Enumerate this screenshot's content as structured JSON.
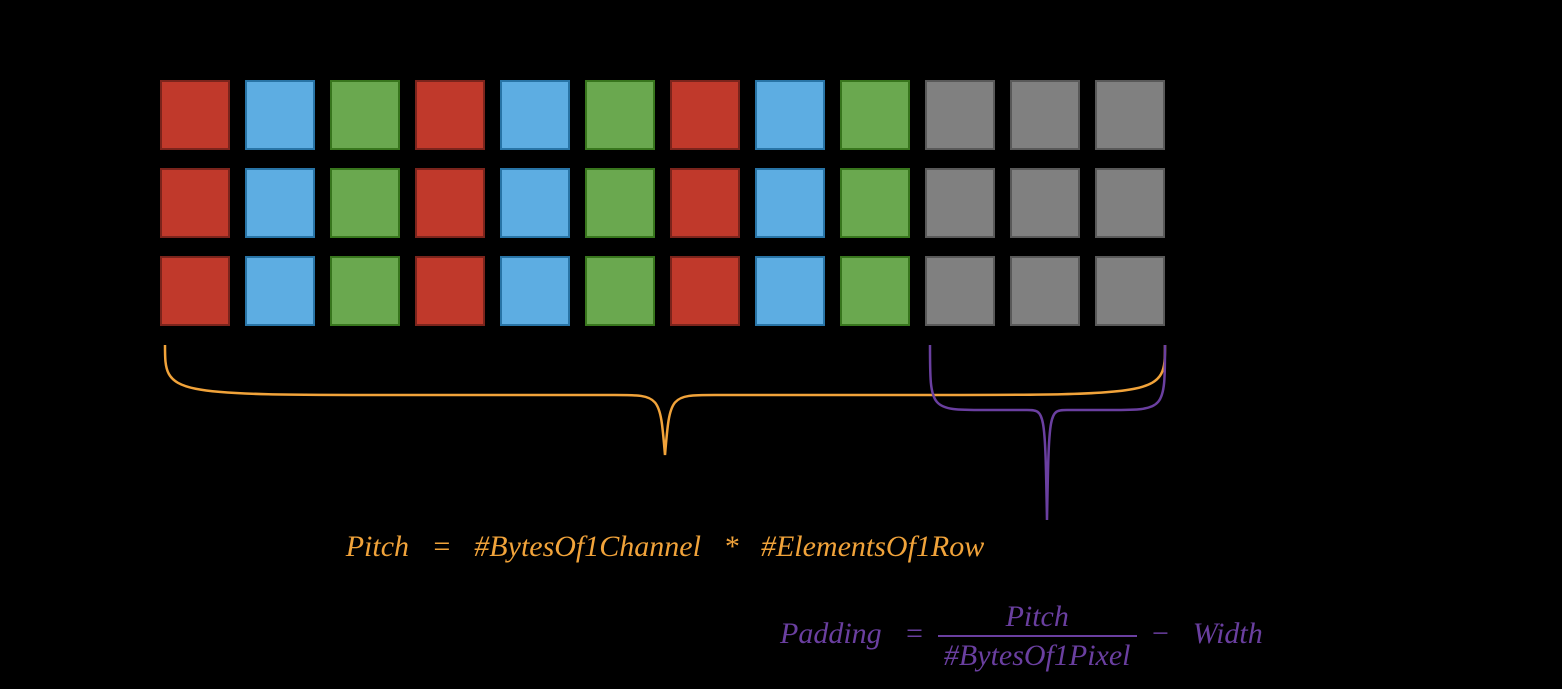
{
  "diagram": {
    "rows": 3,
    "pixel_groups_per_row": 3,
    "channels_per_pixel": [
      "R",
      "G",
      "B"
    ],
    "padding_cells_per_row": 3,
    "colors": {
      "red": "#C0392B",
      "blue": "#5DADE2",
      "green": "#6AA84F",
      "gray": "#808080",
      "pitch_accent": "#F1A33A",
      "padding_accent": "#6A3FA0"
    }
  },
  "formulas": {
    "pitch": {
      "lhs": "Pitch",
      "eq": "=",
      "rhs_a": "#BytesOf1Channel",
      "op": "*",
      "rhs_b": "#ElementsOf1Row"
    },
    "padding": {
      "lhs": "Padding",
      "eq": "=",
      "num": "Pitch",
      "den": "#BytesOf1Pixel",
      "minus": "−",
      "tail": "Width"
    }
  }
}
